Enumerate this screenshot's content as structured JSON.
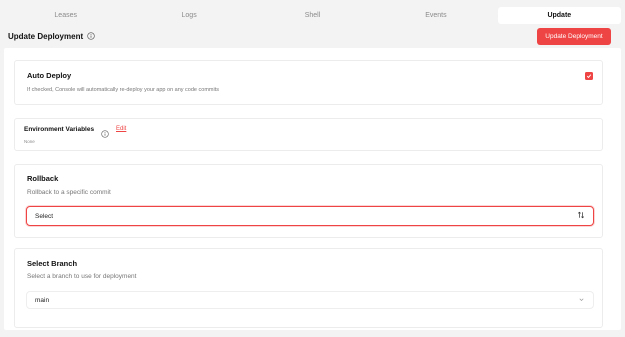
{
  "tabs": [
    {
      "label": "Leases",
      "active": false
    },
    {
      "label": "Logs",
      "active": false
    },
    {
      "label": "Shell",
      "active": false
    },
    {
      "label": "Events",
      "active": false
    },
    {
      "label": "Update",
      "active": true
    }
  ],
  "header": {
    "title": "Update Deployment",
    "info_icon": "info-circle-icon",
    "update_button_label": "Update Deployment"
  },
  "auto_deploy": {
    "title": "Auto Deploy",
    "description": "If checked, Console will automatically re-deploy your app on any code commits",
    "checked": true
  },
  "env_vars": {
    "title": "Environment Variables",
    "edit_label": "Edit",
    "subtitle": "None"
  },
  "rollback": {
    "title": "Rollback",
    "description": "Rollback to a specific commit",
    "select_value": "Select",
    "select_icon": "sort-arrows-icon"
  },
  "branch": {
    "title": "Select Branch",
    "description": "Select a branch to use for deployment",
    "select_value": "main",
    "select_icon": "chevron-down-icon"
  },
  "colors": {
    "accent": "#ef4444",
    "background": "#f3f3f4"
  }
}
